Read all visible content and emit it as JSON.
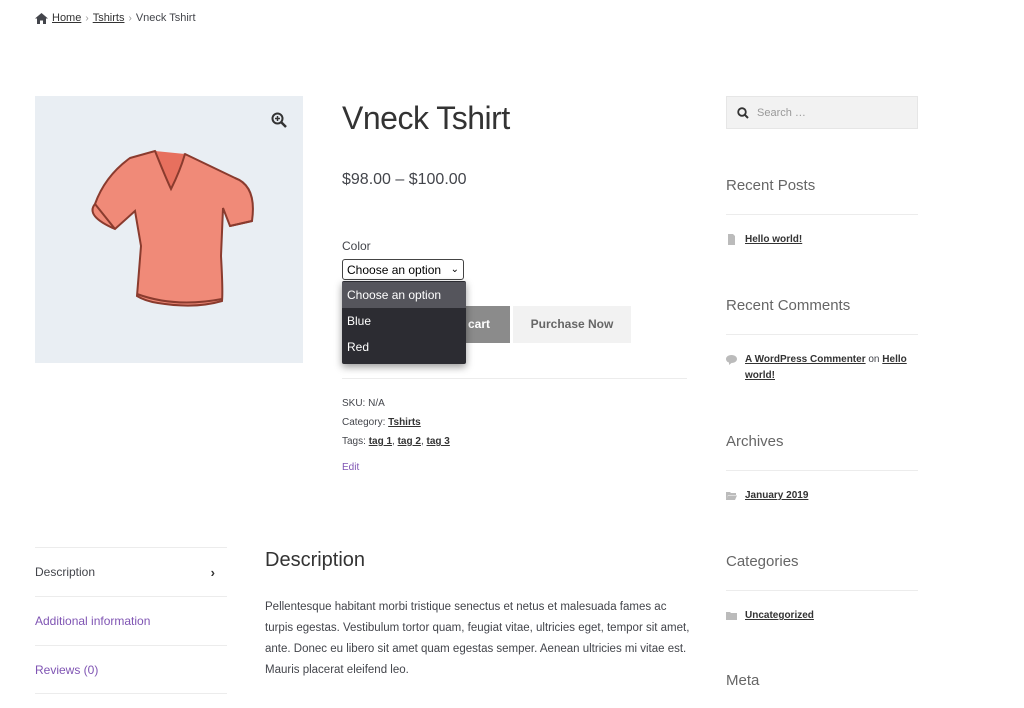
{
  "breadcrumb": {
    "home": "Home",
    "category": "Tshirts",
    "current": "Vneck Tshirt",
    "sep": "›"
  },
  "product": {
    "title": "Vneck Tshirt",
    "price": "$98.00 – $100.00",
    "color_label": "Color",
    "select_value": "Choose an option",
    "options": [
      "Choose an option",
      "Blue",
      "Red"
    ],
    "add_to_cart": "cart",
    "purchase_now": "Purchase Now",
    "sku_label": "SKU:",
    "sku_value": "N/A",
    "category_label": "Category:",
    "category_value": "Tshirts",
    "tags_label": "Tags:",
    "tags": [
      "tag 1",
      "tag 2",
      "tag 3"
    ],
    "edit": "Edit"
  },
  "sidebar": {
    "search_placeholder": "Search …",
    "recent_posts_title": "Recent Posts",
    "recent_post": "Hello world!",
    "recent_comments_title": "Recent Comments",
    "commenter": "A WordPress Commenter",
    "on_text": "on",
    "comment_post": "Hello world!",
    "archives_title": "Archives",
    "archive": "January 2019",
    "categories_title": "Categories",
    "category": "Uncategorized",
    "meta_title": "Meta"
  },
  "tabs": [
    {
      "label": "Description"
    },
    {
      "label": "Additional information"
    },
    {
      "label": "Reviews (0)"
    }
  ],
  "description": {
    "title": "Description",
    "text": "Pellentesque habitant morbi tristique senectus et netus et malesuada fames ac turpis egestas. Vestibulum tortor quam, feugiat vitae, ultricies eget, tempor sit amet, ante. Donec eu libero sit amet quam egestas semper. Aenean ultricies mi vitae est. Mauris placerat eleifend leo."
  },
  "colors": {
    "accent": "#7f54b3",
    "shirt": "#f08a78"
  }
}
